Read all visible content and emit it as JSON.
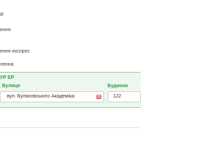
{
  "section": {
    "title": "и"
  },
  "options": [
    {
      "label": "ення"
    },
    {
      "label": "ення експрес"
    },
    {
      "label": "ленна"
    }
  ],
  "address": {
    "title": "УР ЕР",
    "street_label": "Вулиця",
    "street_value": "вул. Булаховського Академіка",
    "house_label": "Будинок",
    "house_value": "122"
  },
  "colors": {
    "accent": "#2e9b44",
    "block_bg": "#eef7ef",
    "block_border": "#8fce98",
    "icon": "#d9534f"
  }
}
